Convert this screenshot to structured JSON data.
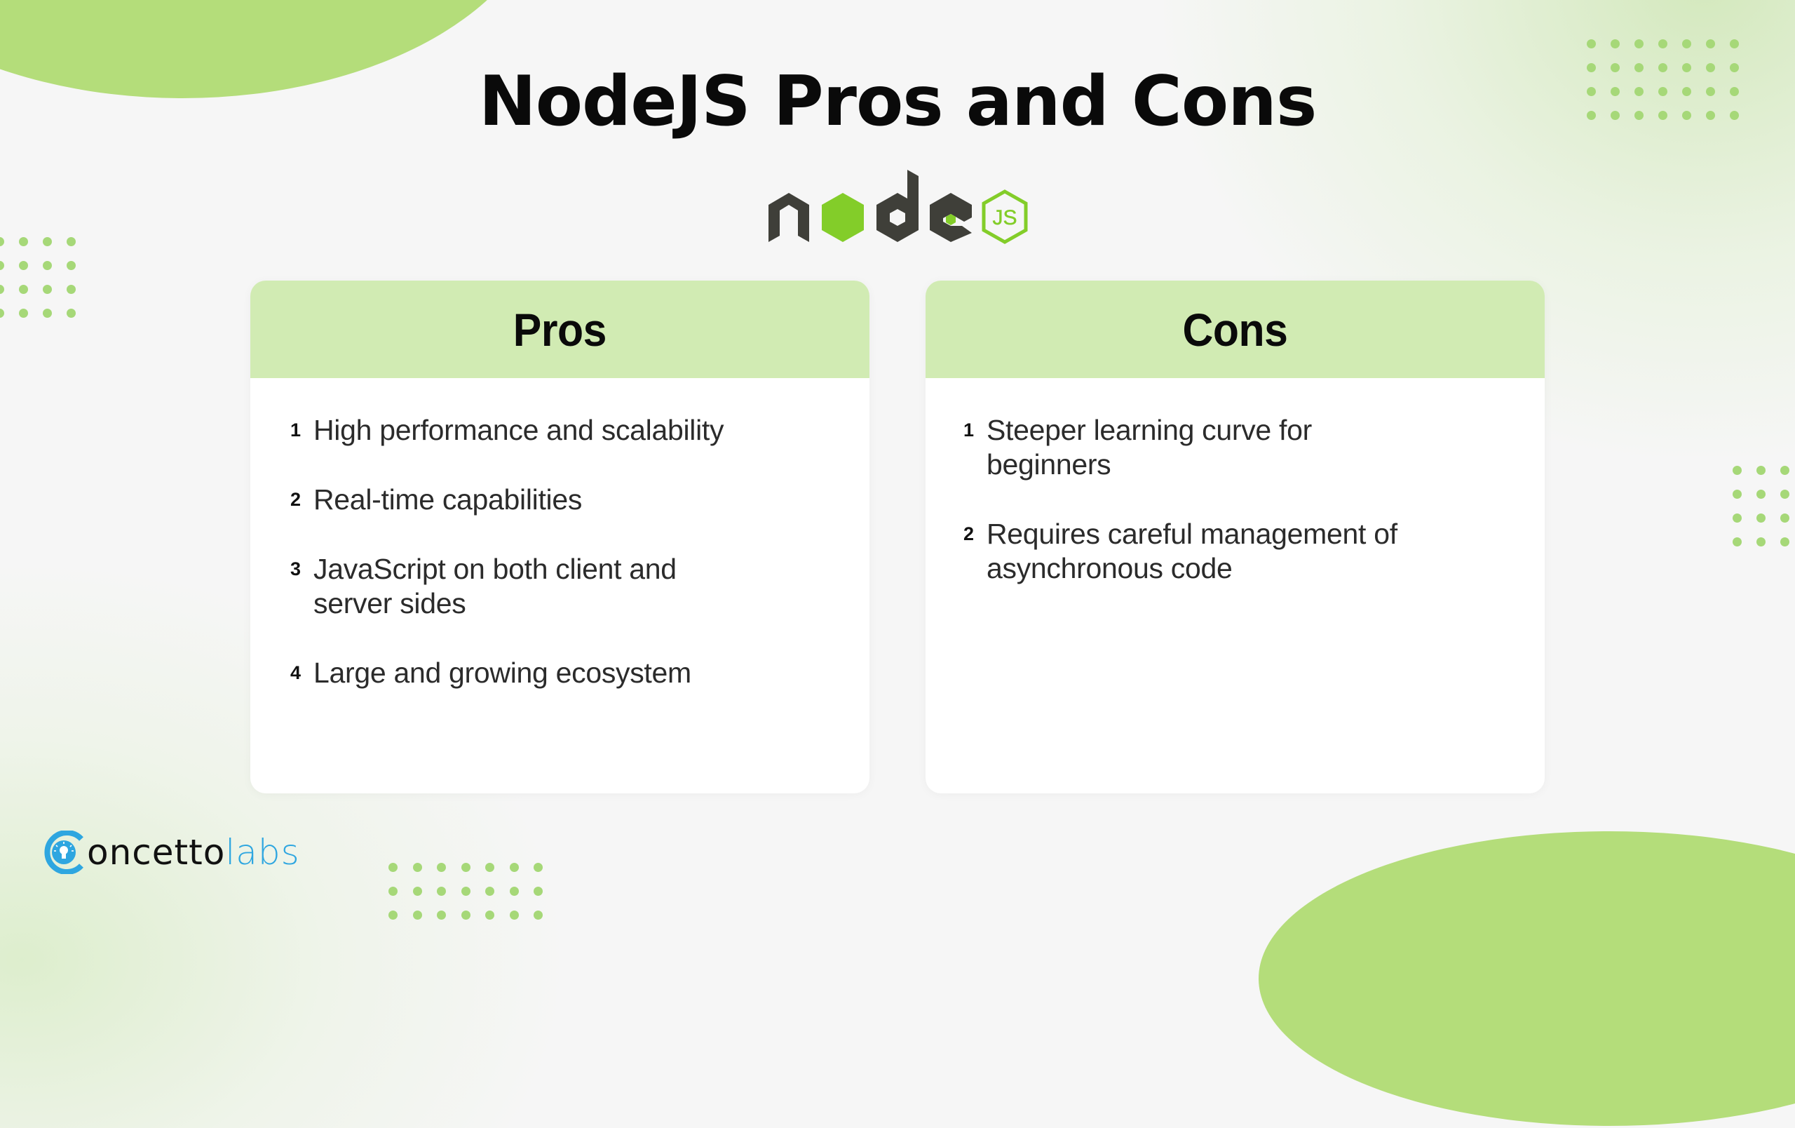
{
  "page": {
    "title": "NodeJS Pros and Cons",
    "logo": {
      "name": "node",
      "badge": "JS",
      "dark_color": "#3f3f39",
      "green_color": "#83cd29"
    }
  },
  "colors": {
    "accent_green": "#b4dd7a",
    "card_header": "#d1ebb3",
    "dot_green": "#a6d878",
    "brand_blue": "#2ea6e0"
  },
  "pros": {
    "title": "Pros",
    "items": [
      {
        "num": "1",
        "text": "High performance and scalability"
      },
      {
        "num": "2",
        "text": "Real-time capabilities"
      },
      {
        "num": "3",
        "text": "JavaScript on both client and server sides"
      },
      {
        "num": "4",
        "text": "Large and growing ecosystem"
      }
    ]
  },
  "cons": {
    "title": "Cons",
    "items": [
      {
        "num": "1",
        "text": "Steeper learning curve for beginners"
      },
      {
        "num": "2",
        "text": "Requires careful management of asynchronous code"
      }
    ]
  },
  "brand": {
    "part_dark": "oncetto",
    "part_light": "labs",
    "icon": "lightbulb-c-icon"
  }
}
